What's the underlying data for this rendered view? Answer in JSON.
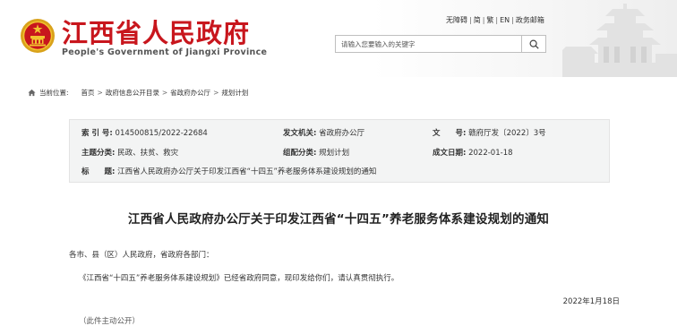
{
  "header": {
    "title": "江西省人民政府",
    "subtitle": "People's Government of Jiangxi Province",
    "top_links": [
      "无障碍",
      "简",
      "繁",
      "EN",
      "政务邮箱"
    ],
    "search_placeholder": "请输入您要输入的关键字",
    "colors": {
      "brand_red": "#c8161d"
    }
  },
  "breadcrumb": {
    "label": "当前位置:",
    "items": [
      "首页",
      "政府信息公开目录",
      "省政府办公厅",
      "规划计划"
    ]
  },
  "info": {
    "index_label": "索 引 号:",
    "index_value": "014500815/2022-22684",
    "issuer_label": "发文机关:",
    "issuer_value": "省政府办公厅",
    "docno_label": "文　　号:",
    "docno_value": "赣府厅发〔2022〕3号",
    "subject_label": "主题分类:",
    "subject_value": "民政、扶贫、救灾",
    "category_label": "组配分类:",
    "category_value": "规划计划",
    "date_label": "成文日期:",
    "date_value": "2022-01-18",
    "title_label": "标　　题:",
    "title_value": "江西省人民政府办公厅关于印发江西省“十四五”养老服务体系建设规划的通知"
  },
  "article": {
    "title": "江西省人民政府办公厅关于印发江西省“十四五”养老服务体系建设规划的通知",
    "salutation": "各市、县（区）人民政府，省政府各部门：",
    "body": "《江西省“十四五”养老服务体系建设规划》已经省政府同意，现印发给你们，请认真贯彻执行。",
    "date": "2022年1月18日",
    "footer_note": "（此件主动公开）"
  },
  "icons": {
    "emblem": "national-emblem-icon",
    "search": "search-icon",
    "home": "home-icon"
  }
}
